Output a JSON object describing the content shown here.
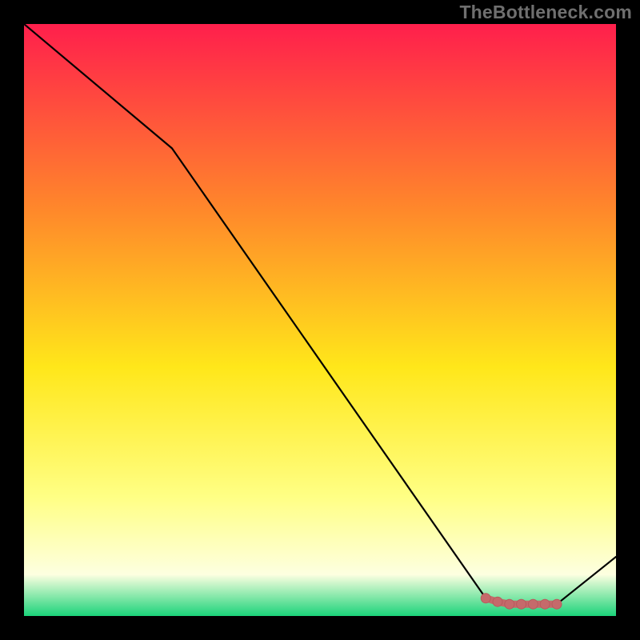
{
  "watermark": "TheBottleneck.com",
  "colors": {
    "background": "#000000",
    "line": "#000000",
    "marker_fill": "#c56a6b",
    "marker_stroke": "#b85a5c",
    "gradient_top": "#ff1f4c",
    "gradient_mid_upper": "#ff8a2a",
    "gradient_mid": "#ffe71a",
    "gradient_mid_lower": "#ffff85",
    "gradient_lower": "#fdffe0",
    "gradient_bottom": "#1bd37a"
  },
  "chart_data": {
    "type": "line",
    "title": "",
    "xlabel": "",
    "ylabel": "",
    "xlim": [
      0,
      100
    ],
    "ylim": [
      0,
      100
    ],
    "series": [
      {
        "name": "curve",
        "x": [
          0,
          25,
          78,
          82,
          86,
          90,
          100
        ],
        "y": [
          100,
          79,
          3,
          2,
          2,
          2,
          10
        ]
      }
    ],
    "markers": {
      "name": "highlight-segment",
      "x": [
        78,
        80,
        82,
        84,
        86,
        88,
        90
      ],
      "y": [
        3.0,
        2.4,
        2.0,
        2.0,
        2.0,
        2.0,
        2.0
      ]
    }
  }
}
